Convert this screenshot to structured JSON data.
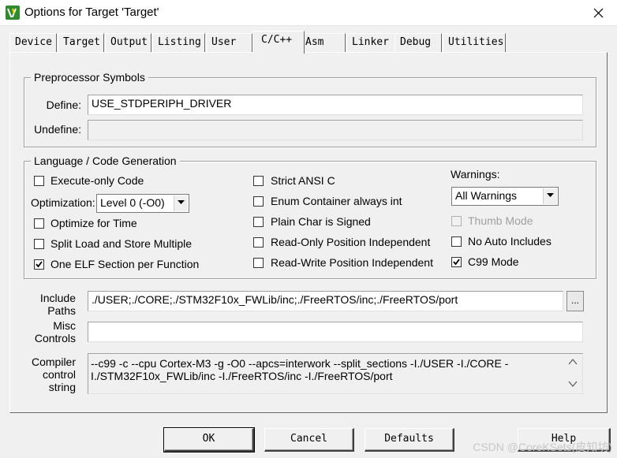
{
  "window": {
    "title": "Options for Target 'Target'",
    "app_icon": "keil-uvision-icon",
    "close_glyph": "✕"
  },
  "tabs": [
    {
      "label": "Device"
    },
    {
      "label": "Target"
    },
    {
      "label": "Output"
    },
    {
      "label": "Listing"
    },
    {
      "label": "User"
    },
    {
      "label": "C/C++",
      "active": true
    },
    {
      "label": "Asm"
    },
    {
      "label": "Linker"
    },
    {
      "label": "Debug"
    },
    {
      "label": "Utilities"
    }
  ],
  "preprocessor": {
    "group_label": "Preprocessor Symbols",
    "define_label": "Define:",
    "define_value": "USE_STDPERIPH_DRIVER",
    "undefine_label": "Undefine:",
    "undefine_value": ""
  },
  "codegen": {
    "group_label": "Language / Code Generation",
    "execute_only": {
      "label": "Execute-only Code",
      "checked": false
    },
    "optimization_label": "Optimization:",
    "optimization_value": "Level 0 (-O0)",
    "optimize_time": {
      "label": "Optimize for Time",
      "checked": false
    },
    "split_load": {
      "label": "Split Load and Store Multiple",
      "checked": false
    },
    "one_elf": {
      "label": "One ELF Section per Function",
      "checked": true
    },
    "strict_ansi": {
      "label": "Strict ANSI C",
      "checked": false
    },
    "enum_container": {
      "label": "Enum Container always int",
      "checked": false
    },
    "plain_char": {
      "label": "Plain Char is Signed",
      "checked": false
    },
    "ropi": {
      "label": "Read-Only Position Independent",
      "checked": false
    },
    "rwpi": {
      "label": "Read-Write Position Independent",
      "checked": false
    },
    "warnings_label": "Warnings:",
    "warnings_value": "All Warnings",
    "thumb_mode": {
      "label": "Thumb Mode",
      "checked": false,
      "disabled": true
    },
    "no_auto_includes": {
      "label": "No Auto Includes",
      "checked": false
    },
    "c99_mode": {
      "label": "C99 Mode",
      "checked": true
    }
  },
  "include_paths": {
    "label_line1": "Include",
    "label_line2": "Paths",
    "value": "./USER;./CORE;./STM32F10x_FWLib/inc;./FreeRTOS/inc;./FreeRTOS/port",
    "browse_label": "..."
  },
  "misc_controls": {
    "label_line1": "Misc",
    "label_line2": "Controls",
    "value": ""
  },
  "compiler_string": {
    "label_line1": "Compiler",
    "label_line2": "control",
    "label_line3": "string",
    "value": "--c99 -c --cpu Cortex-M3 -g -O0 --apcs=interwork --split_sections -I./USER -I./CORE -I./STM32F10x_FWLib/inc -I./FreeRTOS/inc -I./FreeRTOS/port"
  },
  "buttons": {
    "ok": "OK",
    "cancel": "Cancel",
    "defaults": "Defaults",
    "help": "Help"
  },
  "watermark": "CSDN @CoreKSets(皮知坊)"
}
